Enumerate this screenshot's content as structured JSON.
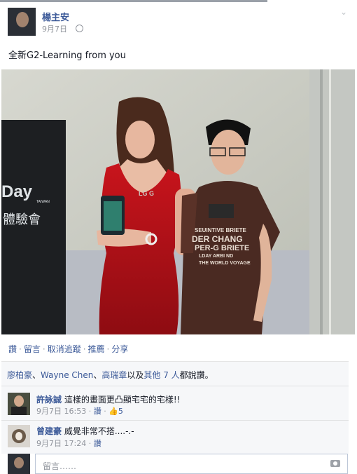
{
  "post": {
    "author": "楊主安",
    "date": "9月7日",
    "privacy_icon": "globe-icon",
    "text": "全新G2-Learning from you"
  },
  "photo": {
    "banner_text": "Day",
    "banner_sub": "體驗會",
    "banner_small": "TAIWAN",
    "belt_text": "LG G",
    "shirt_lines": [
      "SEUINTIVE BRIETE",
      "DER CHANG",
      "PER-G BRIETE",
      "LDAY ARBI ND",
      "THE WORLD VOYAGE"
    ]
  },
  "actions": [
    "讚",
    "留言",
    "取消追蹤",
    "推薦",
    "分享"
  ],
  "likes": {
    "name1": "廖柏豪",
    "sep1": "、",
    "name2": "Wayne Chen",
    "sep2": "、",
    "name3": "高瑞章",
    "mid": "以及",
    "others": "其他 7 人",
    "tail": "都說讚。"
  },
  "comments": [
    {
      "name": "許詠誠",
      "text": "這樣的畫面更凸顯宅宅的宅樣!!",
      "time": "9月7日 16:53",
      "like": "讚",
      "like_count": "5"
    },
    {
      "name": "曾建豪",
      "text": "威覺非常不搭....-.-",
      "time": "9月7日 17:24",
      "like": "讚"
    }
  ],
  "reply": {
    "placeholder": "留言……",
    "camera_icon": "camera-icon"
  }
}
